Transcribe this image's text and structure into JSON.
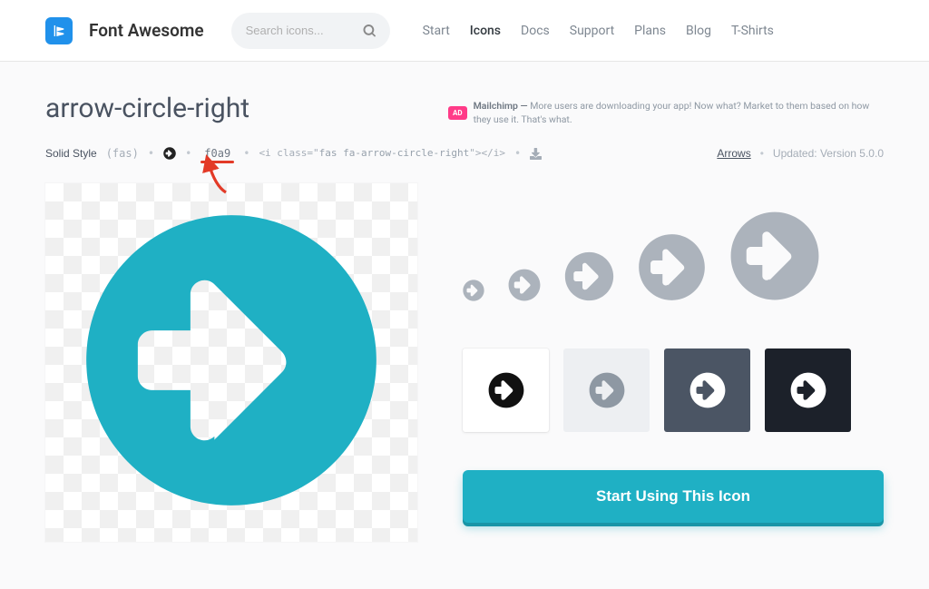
{
  "brand": "Font Awesome",
  "search": {
    "placeholder": "Search icons..."
  },
  "nav": {
    "items": [
      {
        "label": "Start",
        "active": false
      },
      {
        "label": "Icons",
        "active": true
      },
      {
        "label": "Docs",
        "active": false
      },
      {
        "label": "Support",
        "active": false
      },
      {
        "label": "Plans",
        "active": false
      },
      {
        "label": "Blog",
        "active": false
      },
      {
        "label": "T-Shirts",
        "active": false
      }
    ]
  },
  "page": {
    "title": "arrow-circle-right",
    "style_label": "Solid Style",
    "style_prefix": "(fas)",
    "unicode": "f0a9",
    "snippet_prefix": "<i class=\"",
    "snippet_cls": "fas fa-arrow-circle-right",
    "snippet_suffix": "\"></i>",
    "category": "Arrows",
    "updated": "Updated: Version 5.0.0"
  },
  "ad": {
    "badge": "AD",
    "brand": "Mailchimp —",
    "text": "More users are downloading your app! Now what? Market to them based on how they use it. That's what."
  },
  "cta": {
    "label": "Start Using This Icon"
  },
  "colors": {
    "accent": "#1fb0c4",
    "arrow_annotation": "#e33a27"
  }
}
